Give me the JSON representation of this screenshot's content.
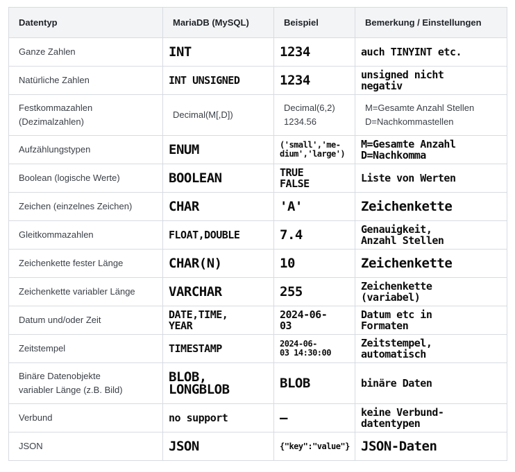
{
  "headers": [
    "Datentyp",
    "MariaDB (MySQL)",
    "Beispiel",
    "Bemerkung / Einstellungen"
  ],
  "rows": [
    {
      "type": "Ganze Zahlen",
      "db": "INT",
      "example": "1234",
      "note": "auch TINYINT etc."
    },
    {
      "type": "Natürliche Zahlen",
      "db": "INT UNSIGNED",
      "example": "1234",
      "note": "unsigned nicht\nnegativ"
    },
    {
      "type": "Festkommazahlen\n(Dezimalzahlen)",
      "db": "Decimal(M[,D])",
      "example": "Decimal(6,2)\n1234.56",
      "note": "M=Gesamte Anzahl Stellen\nD=Nachkommastellen"
    },
    {
      "type": "Aufzählungstypen",
      "db": "ENUM",
      "example": "('small','me-\ndium','large')",
      "note": "M=Gesamte Anzahl\nD=Nachkomma"
    },
    {
      "type": "Boolean (logische Werte)",
      "db": "BOOLEAN",
      "example": "TRUE\nFALSE",
      "note": "Liste von Werten"
    },
    {
      "type": "Zeichen (einzelnes Zeichen)",
      "db": "CHAR",
      "example": "'A'",
      "note": "Zeichenkette"
    },
    {
      "type": "Gleitkommazahlen",
      "db": "FLOAT,DOUBLE",
      "example": "7.4",
      "note": "Genauigkeit,\nAnzahl Stellen"
    },
    {
      "type": "Zeichenkette fester Länge",
      "db": "CHAR(N)",
      "example": "10",
      "note": "Zeichenkette"
    },
    {
      "type": "Zeichenkette variabler Länge",
      "db": "VARCHAR",
      "example": "255",
      "note": "Zeichenkette\n(variabel)"
    },
    {
      "type": "Datum und/oder Zeit",
      "db": "DATE,TIME,\nYEAR",
      "example": "2024-06-\n03",
      "note": "Datum etc in\nFormaten"
    },
    {
      "type": "Zeitstempel",
      "db": "TIMESTAMP",
      "example": "2024-06-\n03 14:30:00",
      "note": "Zeitstempel,\nautomatisch"
    },
    {
      "type": "Binäre Datenobjekte\nvariabler Länge (z.B. Bild)",
      "db": "BLOB,\nLONGBLOB",
      "example": "BLOB",
      "note": "binäre Daten"
    },
    {
      "type": "Verbund",
      "db": "no support",
      "example": "—",
      "note": "keine Verbund-\ndatentypen"
    },
    {
      "type": "JSON",
      "db": "JSON",
      "example": "{\"key\":\"value\"}",
      "note": "JSON-Daten"
    }
  ]
}
